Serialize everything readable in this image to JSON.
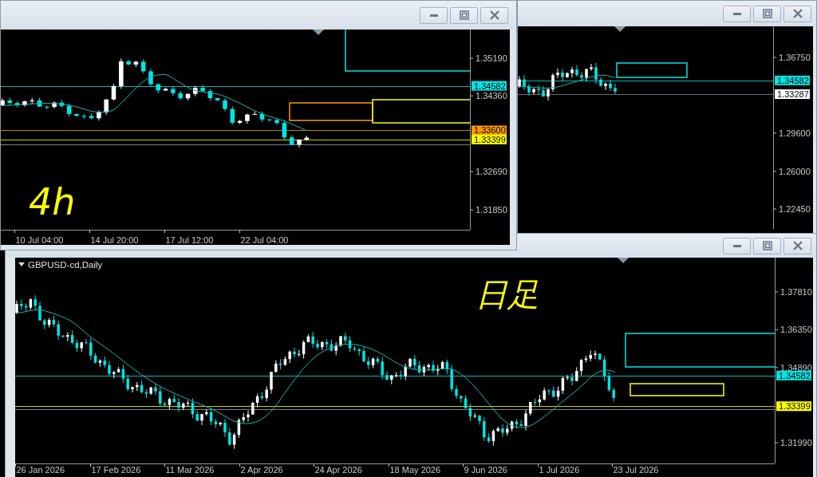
{
  "windows": [
    {
      "kind": "h4",
      "ticks": [
        "1.35190",
        "1.34360",
        "1.32690",
        "1.31850"
      ],
      "levels": [
        {
          "label": "1.34582",
          "color": "#00e5e5"
        },
        {
          "label": "1.33600",
          "color": "#ff9900"
        },
        {
          "label": "1.33399",
          "color": "#ffff00"
        }
      ],
      "dates": [
        "10 Jul 04:00",
        "14 Jul 20:00",
        "17 Jul 12:00",
        "22 Jul 04:00"
      ],
      "note": "4h"
    },
    {
      "kind": "overview",
      "ticks": [
        "1.36750",
        "1.29600",
        "1.26000",
        "1.22450"
      ],
      "levels": [
        {
          "label": "1.34582",
          "color": "#00e5e5"
        },
        {
          "label": "1.33287",
          "color": "#ffffff"
        }
      ]
    },
    {
      "kind": "daily",
      "title": "GBPUSD-cd,Daily",
      "ticks": [
        "1.37810",
        "1.36350",
        "1.34890",
        "1.31990"
      ],
      "levels": [
        {
          "label": "1.34582",
          "color": "#00e5e5"
        },
        {
          "label": "1.33399",
          "color": "#ffff00"
        }
      ],
      "dates": [
        "26 Jan 2026",
        "17 Feb 2026",
        "11 Mar 2026",
        "2 Apr 2026",
        "24 Apr 2026",
        "18 May 2026",
        "9 Jun 2026",
        "1 Jul 2026",
        "23 Jul 2026"
      ],
      "note": "日足"
    }
  ]
}
